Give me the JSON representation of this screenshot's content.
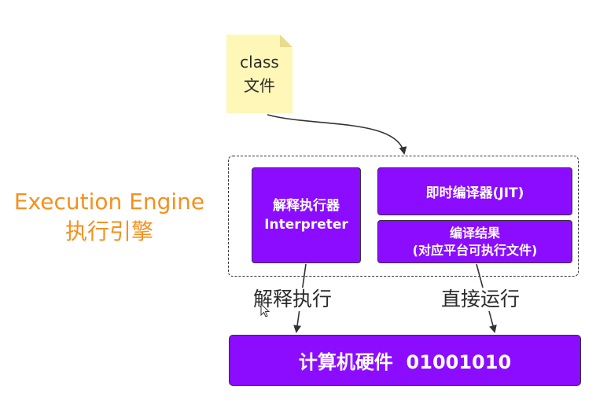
{
  "class_file": {
    "line1": "class",
    "line2": "文件"
  },
  "engine": {
    "label_en": "Execution Engine",
    "label_zh": "执行引擎"
  },
  "interpreter": {
    "line1": "解释执行器",
    "line2": "Interpreter"
  },
  "jit": {
    "label": "即时编译器(JIT)"
  },
  "compile_result": {
    "line1": "编译结果",
    "line2": "(对应平台可执行文件)"
  },
  "edges": {
    "interpret": "解释执行",
    "direct_run": "直接运行"
  },
  "hardware": {
    "label": "计算机硬件  01001010"
  },
  "colors": {
    "box_purple": "#8b0cff",
    "label_orange": "#f5901e",
    "note_yellow": "#fff7b8"
  }
}
